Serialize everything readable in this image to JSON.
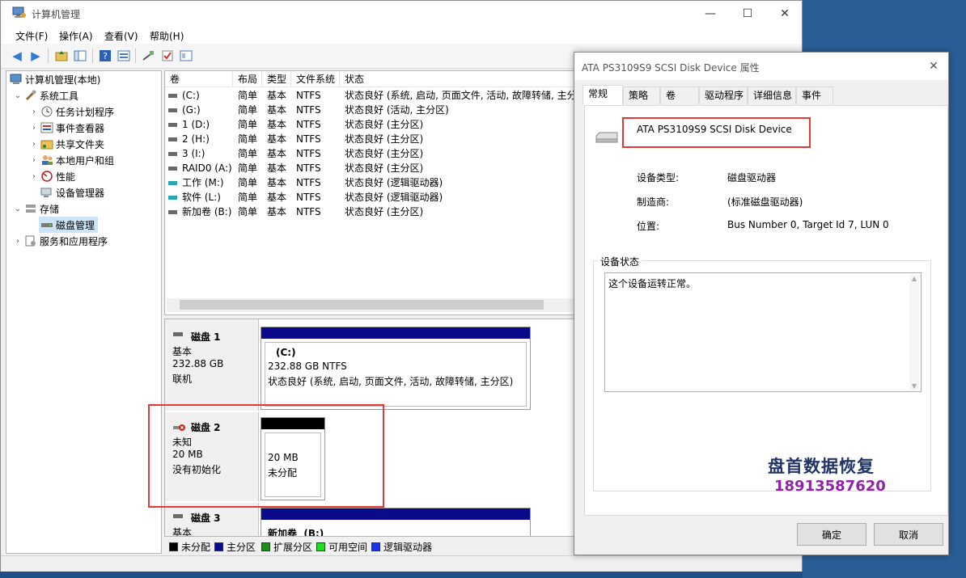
{
  "window": {
    "title": "计算机管理",
    "minimize": "—",
    "maximize": "☐",
    "close": "✕"
  },
  "menu": [
    "文件(F)",
    "操作(A)",
    "查看(V)",
    "帮助(H)"
  ],
  "tree": {
    "root": "计算机管理(本地)",
    "system_tools": "系统工具",
    "task_scheduler": "任务计划程序",
    "event_viewer": "事件查看器",
    "shared_folders": "共享文件夹",
    "local_users": "本地用户和组",
    "performance": "性能",
    "device_manager": "设备管理器",
    "storage": "存储",
    "disk_management": "磁盘管理",
    "services": "服务和应用程序"
  },
  "volume_list": {
    "headers": [
      "卷",
      "布局",
      "类型",
      "文件系统",
      "状态"
    ],
    "rows": [
      {
        "name": "(C:)",
        "layout": "简单",
        "type": "基本",
        "fs": "NTFS",
        "status": "状态良好 (系统, 启动, 页面文件, 活动, 故障转储, 主分",
        "icon": "gray"
      },
      {
        "name": "(G:)",
        "layout": "简单",
        "type": "基本",
        "fs": "NTFS",
        "status": "状态良好 (活动, 主分区)",
        "icon": "gray"
      },
      {
        "name": "1 (D:)",
        "layout": "简单",
        "type": "基本",
        "fs": "NTFS",
        "status": "状态良好 (主分区)",
        "icon": "gray"
      },
      {
        "name": "2 (H:)",
        "layout": "简单",
        "type": "基本",
        "fs": "NTFS",
        "status": "状态良好 (主分区)",
        "icon": "gray"
      },
      {
        "name": "3 (I:)",
        "layout": "简单",
        "type": "基本",
        "fs": "NTFS",
        "status": "状态良好 (主分区)",
        "icon": "gray"
      },
      {
        "name": "RAID0 (A:)",
        "layout": "简单",
        "type": "基本",
        "fs": "NTFS",
        "status": "状态良好 (主分区)",
        "icon": "gray"
      },
      {
        "name": "工作 (M:)",
        "layout": "简单",
        "type": "基本",
        "fs": "NTFS",
        "status": "状态良好 (逻辑驱动器)",
        "icon": "teal"
      },
      {
        "name": "软件 (L:)",
        "layout": "简单",
        "type": "基本",
        "fs": "NTFS",
        "status": "状态良好 (逻辑驱动器)",
        "icon": "teal"
      },
      {
        "name": "新加卷 (B:)",
        "layout": "简单",
        "type": "基本",
        "fs": "NTFS",
        "status": "状态良好 (主分区)",
        "icon": "gray"
      }
    ]
  },
  "disks": {
    "disk1": {
      "title": "磁盘 1",
      "type": "基本",
      "size": "232.88 GB",
      "state": "联机",
      "vol_name": "(C:)",
      "vol_size": "232.88 GB NTFS",
      "vol_status": "状态良好 (系统, 启动, 页面文件, 活动, 故障转储, 主分区)"
    },
    "disk2": {
      "title": "磁盘 2",
      "type": "未知",
      "size": "20 MB",
      "state": "没有初始化",
      "vol_size": "20 MB",
      "vol_status": "未分配"
    },
    "disk3": {
      "title": "磁盘 3",
      "type": "基本",
      "vol_name": "新加卷  (B:)"
    }
  },
  "legend": [
    {
      "label": "未分配",
      "color": "#000000"
    },
    {
      "label": "主分区",
      "color": "#0a0a8a"
    },
    {
      "label": "扩展分区",
      "color": "#1e8c1e"
    },
    {
      "label": "可用空间",
      "color": "#22dd22"
    },
    {
      "label": "逻辑驱动器",
      "color": "#1a33e6"
    }
  ],
  "dialog": {
    "title": "ATA PS3109S9 SCSI Disk Device 属性",
    "close": "✕",
    "tabs": [
      "常规",
      "策略",
      "卷",
      "驱动程序",
      "详细信息",
      "事件"
    ],
    "device_name": "ATA PS3109S9 SCSI Disk Device",
    "props": [
      {
        "label": "设备类型:",
        "value": "磁盘驱动器"
      },
      {
        "label": "制造商:",
        "value": "(标准磁盘驱动器)"
      },
      {
        "label": "位置:",
        "value": "Bus Number 0, Target Id 7, LUN 0"
      }
    ],
    "status_group": "设备状态",
    "status_text": "这个设备运转正常。",
    "ok": "确定",
    "cancel": "取消"
  },
  "watermark": {
    "line1": "盘首数据恢复",
    "line2": "18913587620"
  },
  "colors": {
    "accent_red": "#e53935",
    "primary_partition": "#0a0a8a",
    "selection": "#cce4f7"
  }
}
